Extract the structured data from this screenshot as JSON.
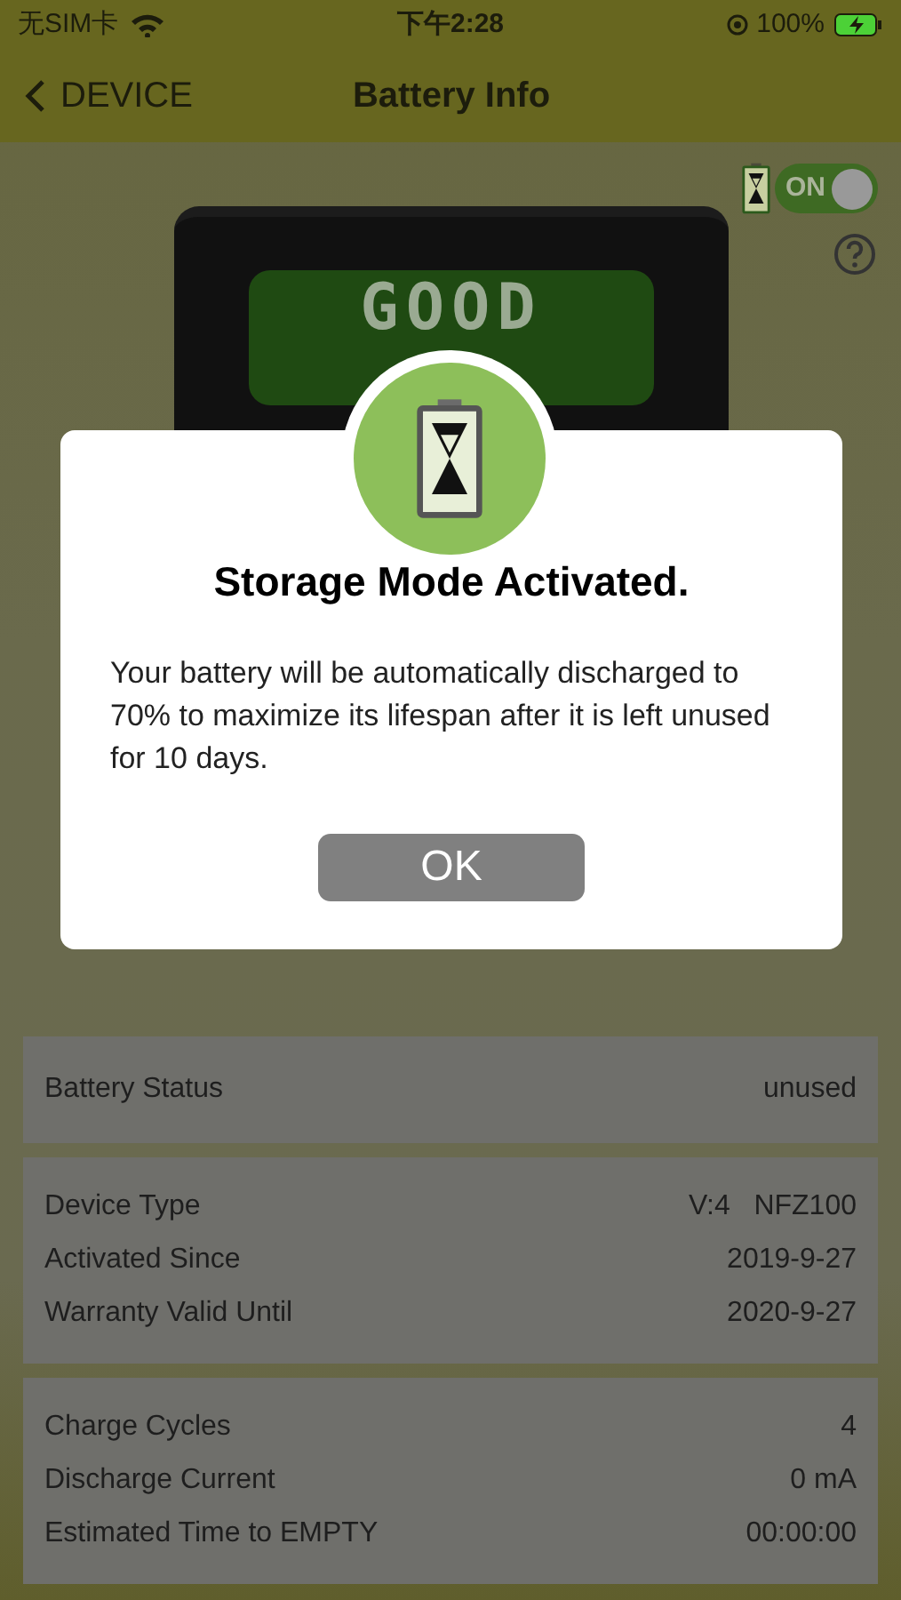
{
  "status_bar": {
    "carrier": "无SIM卡",
    "time": "下午2:28",
    "battery": "100%"
  },
  "nav": {
    "back": "DEVICE",
    "title": "Battery Info"
  },
  "storage_toggle": {
    "label": "ON",
    "on": true
  },
  "device": {
    "display": "GOOD"
  },
  "dialog": {
    "title": "Storage Mode Activated.",
    "message": "Your battery will be automatically discharged to 70% to maximize its lifespan after it is left unused for 10 days.",
    "button": "OK"
  },
  "sections": [
    {
      "rows": [
        {
          "label": "Battery Status",
          "value": "unused"
        }
      ]
    },
    {
      "rows": [
        {
          "label": "Device Type",
          "value": "V:4   NFZ100"
        },
        {
          "label": "Activated Since",
          "value": "2019-9-27"
        },
        {
          "label": "Warranty Valid Until",
          "value": "2020-9-27"
        }
      ]
    },
    {
      "rows": [
        {
          "label": "Charge Cycles",
          "value": "4"
        },
        {
          "label": "Discharge Current",
          "value": "0 mA"
        },
        {
          "label": "Estimated Time to EMPTY",
          "value": "00:00:00"
        }
      ]
    }
  ]
}
